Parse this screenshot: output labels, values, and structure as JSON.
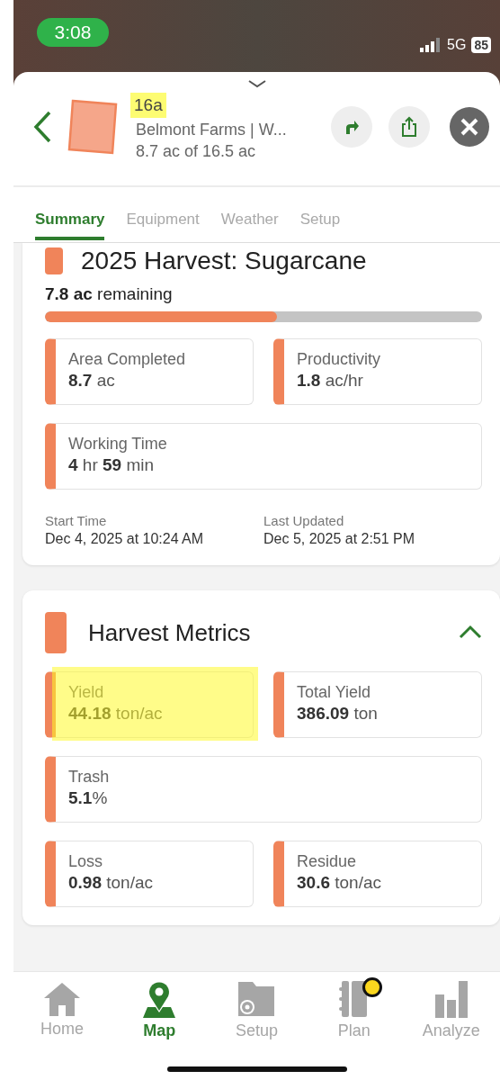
{
  "status_bar": {
    "time": "3:08",
    "network": "5G",
    "battery": "85"
  },
  "field": {
    "name": "16a",
    "name_highlighted": true,
    "farm": "Belmont Farms | W...",
    "area": "8.7 ac of 16.5 ac"
  },
  "tabs": [
    {
      "label": "Summary",
      "selected": true
    },
    {
      "label": "Equipment",
      "selected": false
    },
    {
      "label": "Weather",
      "selected": false
    },
    {
      "label": "Setup",
      "selected": false
    }
  ],
  "operation": {
    "title": "2025 Harvest: Sugarcane",
    "remaining": "**7.8 ac** remaining",
    "level": 0.53,
    "metrics": [
      {
        "label": "Area Completed",
        "value": "**8.7** ac",
        "wide": false
      },
      {
        "label": "Productivity",
        "value": "**1.8** ac/hr",
        "wide": false
      },
      {
        "label": "Working Time",
        "value": "**4** hr **59** min",
        "wide": true
      }
    ],
    "times": [
      {
        "label": "Start Time",
        "value": "Dec 4, 2025 at 10:24 AM"
      },
      {
        "label": "Last Updated",
        "value": "Dec 5, 2025 at 2:51 PM"
      }
    ]
  },
  "harvest_metrics": {
    "title": "Harvest Metrics",
    "expanded": true,
    "metrics": [
      {
        "label": "Yield",
        "value": "**44.18** ton/ac",
        "wide": false,
        "highlighted": true
      },
      {
        "label": "Total Yield",
        "value": "**386.09** ton",
        "wide": false,
        "highlighted": false
      },
      {
        "label": "Trash",
        "value": "**5.1**%",
        "wide": true,
        "highlighted": false
      },
      {
        "label": "Loss",
        "value": "**0.98** ton/ac",
        "wide": false,
        "highlighted": false
      },
      {
        "label": "Residue",
        "value": "**30.6** ton/ac",
        "wide": false,
        "highlighted": false
      }
    ]
  },
  "bottom_nav": [
    {
      "label": "Home",
      "kind": "home",
      "selected": false,
      "badge": false
    },
    {
      "label": "Map",
      "kind": "map",
      "selected": true,
      "badge": false
    },
    {
      "label": "Setup",
      "kind": "setup",
      "selected": false,
      "badge": false
    },
    {
      "label": "Plan",
      "kind": "plan",
      "selected": false,
      "badge": true
    },
    {
      "label": "Analyze",
      "kind": "analyze",
      "selected": false,
      "badge": false
    }
  ]
}
